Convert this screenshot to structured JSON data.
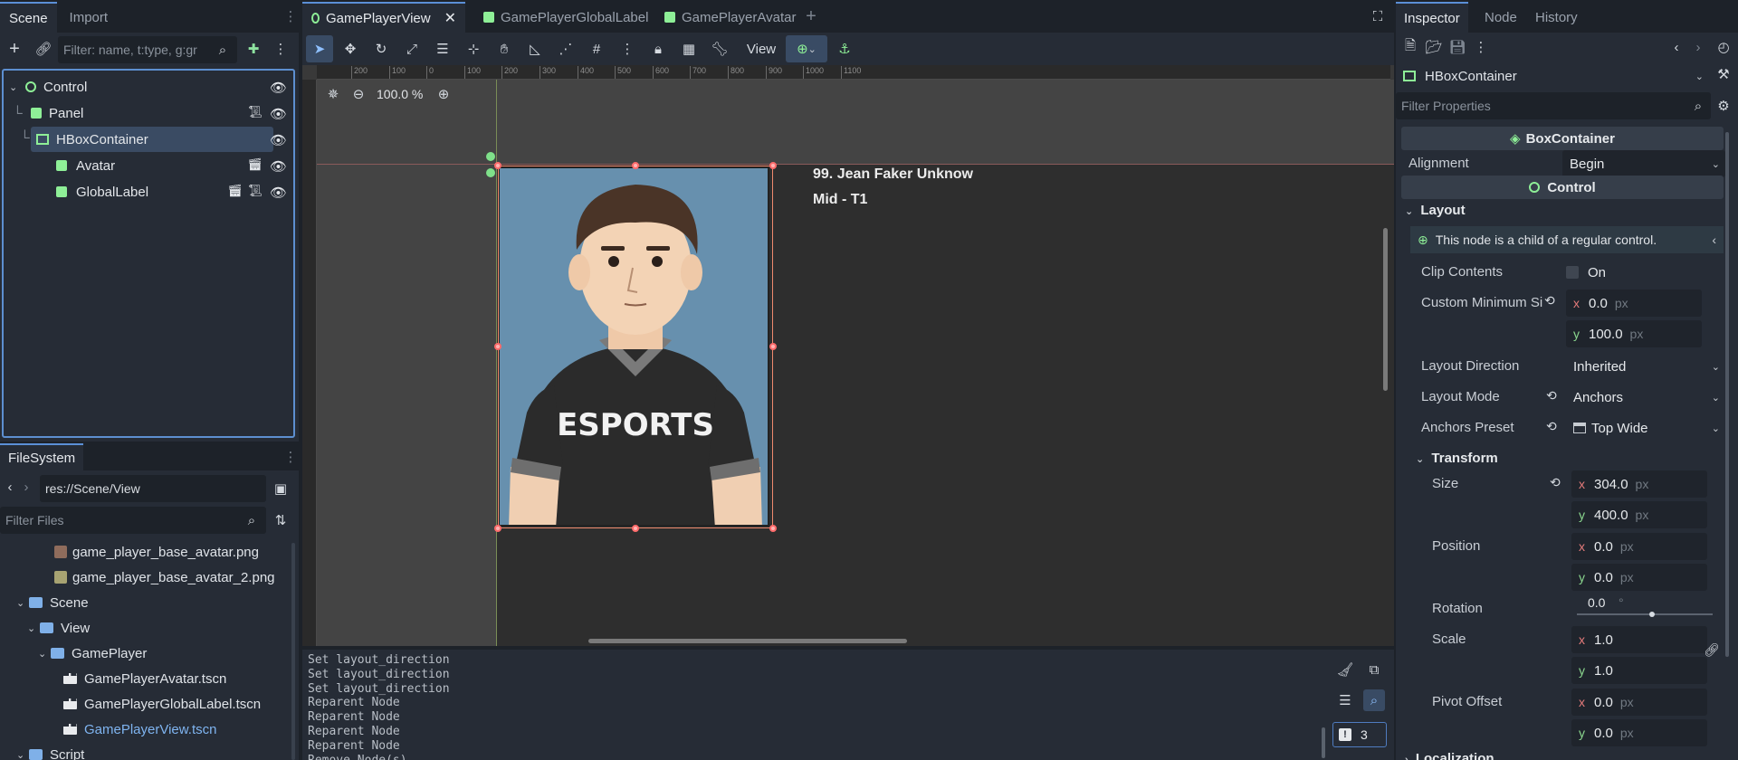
{
  "scene_dock": {
    "tabs": [
      "Scene",
      "Import"
    ],
    "filter_placeholder": "Filter: name, t:type, g:gr",
    "tree": [
      {
        "label": "Control",
        "kind": "control"
      },
      {
        "label": "Panel",
        "kind": "panel"
      },
      {
        "label": "HBoxContainer",
        "kind": "hbox"
      },
      {
        "label": "Avatar",
        "kind": "scene"
      },
      {
        "label": "GlobalLabel",
        "kind": "scene"
      }
    ]
  },
  "filesystem": {
    "tab": "FileSystem",
    "path": "res://Scene/View",
    "filter_placeholder": "Filter Files",
    "items": [
      {
        "label": "game_player_base_avatar.png",
        "type": "image"
      },
      {
        "label": "game_player_base_avatar_2.png",
        "type": "image"
      },
      {
        "label": "Scene",
        "type": "folder"
      },
      {
        "label": "View",
        "type": "folder"
      },
      {
        "label": "GamePlayer",
        "type": "folder"
      },
      {
        "label": "GamePlayerAvatar.tscn",
        "type": "scene"
      },
      {
        "label": "GamePlayerGlobalLabel.tscn",
        "type": "scene"
      },
      {
        "label": "GamePlayerView.tscn",
        "type": "scene"
      },
      {
        "label": "Script",
        "type": "folder"
      }
    ]
  },
  "editor": {
    "tabs": [
      {
        "label": "GamePlayerView"
      },
      {
        "label": "GamePlayerGlobalLabel"
      },
      {
        "label": "GamePlayerAvatar"
      }
    ],
    "view_menu": "View",
    "zoom": "100.0 %",
    "ruler_ticks": [
      "200",
      "100",
      "0",
      "100",
      "200",
      "300",
      "400",
      "500",
      "600",
      "700",
      "800",
      "900",
      "1000",
      "1100"
    ],
    "canvas_label_line1": "99. Jean Faker Unknow",
    "canvas_label_line2": "Mid - T1",
    "avatar_shirt_text": "ESPORTS"
  },
  "output": {
    "lines": [
      "Set layout_direction",
      "Set layout_direction",
      "Set layout_direction",
      "Reparent Node",
      "Reparent Node",
      "Reparent Node",
      "Reparent Node",
      "Remove Node(s)"
    ],
    "badge_count": "3"
  },
  "inspector": {
    "tabs": [
      "Inspector",
      "Node",
      "History"
    ],
    "node_type": "HBoxContainer",
    "filter_placeholder": "Filter Properties",
    "section_box": "BoxContainer",
    "alignment": {
      "label": "Alignment",
      "value": "Begin"
    },
    "section_control": "Control",
    "layout_header": "Layout",
    "layout_note": "This node is a child of a regular control.",
    "clip_contents": {
      "label": "Clip Contents",
      "value": "On"
    },
    "custom_min_size": {
      "label": "Custom Minimum Si",
      "x": "0.0",
      "y": "100.0",
      "unit": "px"
    },
    "layout_direction": {
      "label": "Layout Direction",
      "value": "Inherited"
    },
    "layout_mode": {
      "label": "Layout Mode",
      "value": "Anchors"
    },
    "anchors_preset": {
      "label": "Anchors Preset",
      "value": "Top Wide"
    },
    "transform_header": "Transform",
    "size": {
      "label": "Size",
      "x": "304.0",
      "y": "400.0",
      "unit": "px"
    },
    "position": {
      "label": "Position",
      "x": "0.0",
      "y": "0.0",
      "unit": "px"
    },
    "rotation": {
      "label": "Rotation",
      "value": "0.0",
      "unit": "°"
    },
    "scale": {
      "label": "Scale",
      "x": "1.0",
      "y": "1.0"
    },
    "pivot_offset": {
      "label": "Pivot Offset",
      "x": "0.0",
      "y": "0.0",
      "unit": "px"
    },
    "next_header": "Localization",
    "axis_x": "x",
    "axis_y": "y"
  }
}
